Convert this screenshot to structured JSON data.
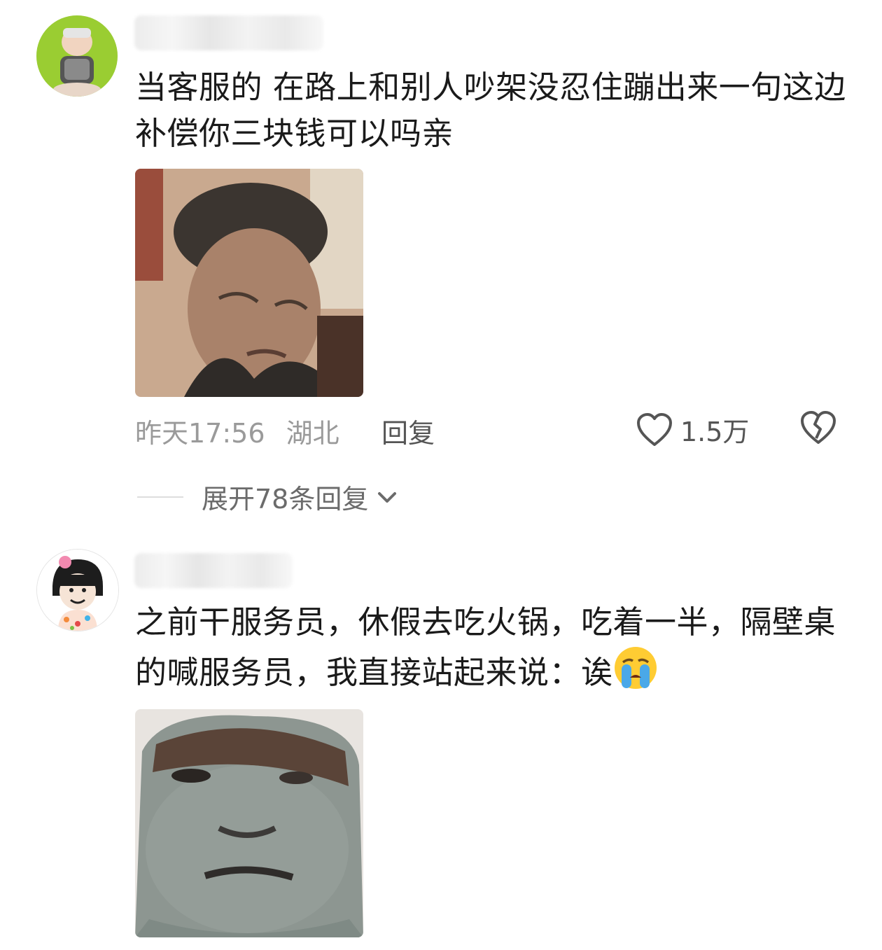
{
  "comments": [
    {
      "text": "当客服的 在路上和别人吵架没忍住蹦出来一句这边补偿你三块钱可以吗亲",
      "time": "昨天17:56",
      "location": "湖北",
      "reply_label": "回复",
      "like_count": "1.5万",
      "expand_label": "展开78条回复"
    },
    {
      "text": "之前干服务员，休假去吃火锅，吃着一半，隔壁桌的喊服务员，我直接站起来说：诶",
      "emoji": "loudly-crying-face"
    }
  ],
  "icons": [
    "heart-icon",
    "broken-heart-icon",
    "chevron-down-icon"
  ],
  "colors": {
    "text": "#1a1a1a",
    "meta": "#9a9a9a",
    "background": "#ffffff"
  }
}
